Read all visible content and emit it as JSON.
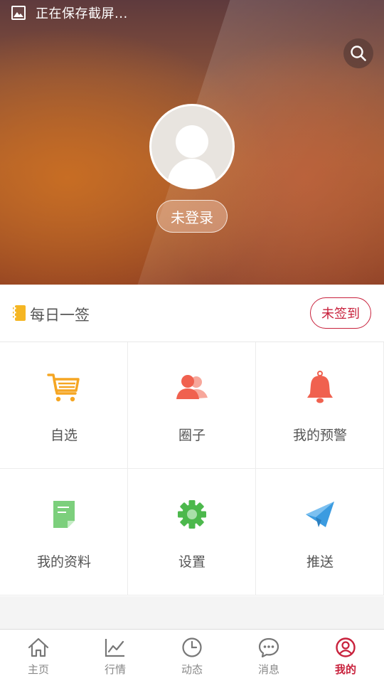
{
  "status_bar": {
    "text": "正在保存截屏..."
  },
  "profile": {
    "login_label": "未登录"
  },
  "daily": {
    "title": "每日一签",
    "button": "未签到"
  },
  "grid": [
    {
      "label": "自选",
      "icon": "cart-icon",
      "color": "#f5a623"
    },
    {
      "label": "圈子",
      "icon": "people-icon",
      "color": "#f0614f"
    },
    {
      "label": "我的预警",
      "icon": "bell-icon",
      "color": "#f0614f"
    },
    {
      "label": "我的资料",
      "icon": "document-icon",
      "color": "#6cc46c"
    },
    {
      "label": "设置",
      "icon": "gear-icon",
      "color": "#4cb84c"
    },
    {
      "label": "推送",
      "icon": "paper-plane-icon",
      "color": "#3b9be0"
    }
  ],
  "tabs": [
    {
      "label": "主页",
      "icon": "home-icon",
      "active": false
    },
    {
      "label": "行情",
      "icon": "chart-line-icon",
      "active": false
    },
    {
      "label": "动态",
      "icon": "clock-icon",
      "active": false
    },
    {
      "label": "消息",
      "icon": "chat-bubble-icon",
      "active": false
    },
    {
      "label": "我的",
      "icon": "user-circle-icon",
      "active": true
    }
  ],
  "colors": {
    "accent": "#c8213c"
  }
}
